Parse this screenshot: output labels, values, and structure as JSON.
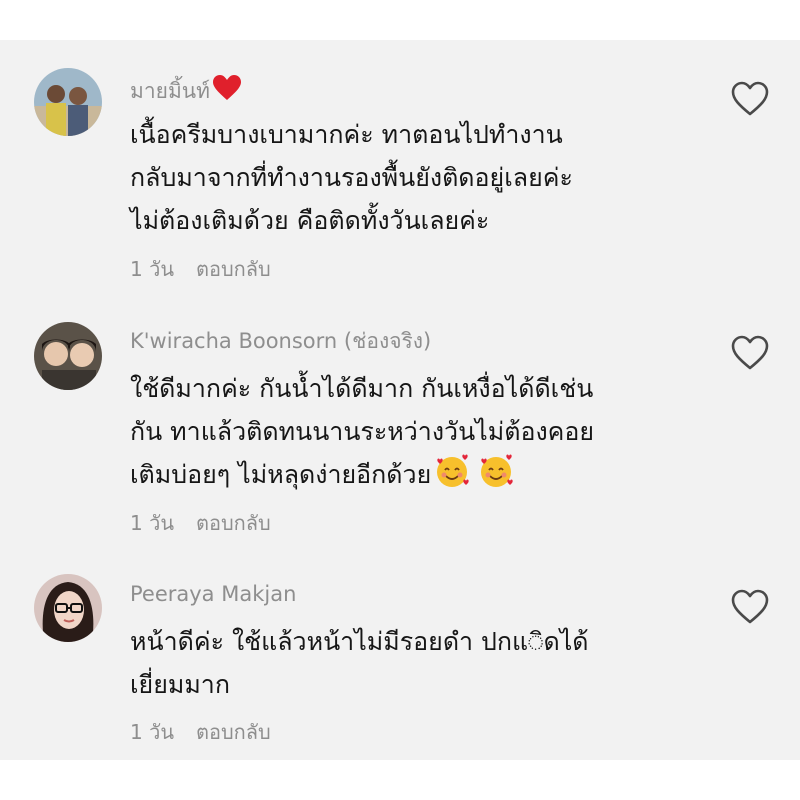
{
  "comments": [
    {
      "username": "มายมิ้นท์",
      "username_emoji": "heart-emoji",
      "lines": [
        "เนื้อครีมบางเบามากค่ะ ทาตอนไปทำงาน",
        "กลับมาจากที่ทำงานรองพื้นยังติดอยู่เลยค่ะ",
        "ไม่ต้องเติมด้วย คือติดทั้งวันเลยค่ะ"
      ],
      "time": "1 วัน",
      "reply_label": "ตอบกลับ",
      "like_icon": "heart-outline-icon"
    },
    {
      "username": "K'wiracha Boonsorn (ช่องจริง)",
      "lines": [
        "ใช้ดีมากค่ะ กันน้ำได้ดีมาก กันเหงื่อได้ดีเช่น",
        "กัน ทาแล้วติดทนนานระหว่างวันไม่ต้องคอย",
        "เติมบ่อยๆ ไม่หลุดง่ายอีกด้วย"
      ],
      "line_emojis": [
        "smiling-face-with-hearts-emoji",
        "smiling-face-with-hearts-emoji"
      ],
      "time": "1 วัน",
      "reply_label": "ตอบกลับ",
      "like_icon": "heart-outline-icon"
    },
    {
      "username": "Peeraya Makjan",
      "lines": [
        "หน้าดีค่ะ ใช้แล้วหน้าไม่มีรอยดำ ปกแ◌ิดได้",
        "เยี่ยมมาก"
      ],
      "time": "1 วัน",
      "reply_label": "ตอบกลับ",
      "like_icon": "heart-outline-icon"
    }
  ],
  "colors": {
    "panel_background": "#f2f2f2",
    "username": "#8e8e8e",
    "body_text": "#161616",
    "meta_text": "#8e8e8e",
    "heart_emoji": "#e0202c",
    "like_icon_stroke": "#4a4a4a"
  }
}
